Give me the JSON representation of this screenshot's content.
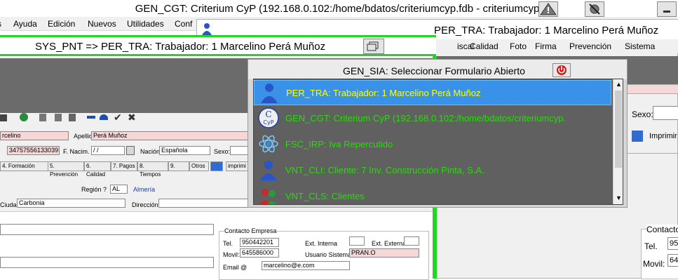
{
  "main_window": {
    "title": "GEN_CGT: Criterium CyP (192.168.0.102:/home/bdatos/criteriumcyp.fdb - criteriumcyp)",
    "menu": [
      "s",
      "Ayuda",
      "Edición",
      "Nuevos",
      "Utilidades",
      "Conf"
    ]
  },
  "pertra_window": {
    "title": "PER_TRA: Trabajador: 1 Marcelino Perá Muñoz",
    "menu": [
      "iscal",
      "Calidad",
      "Foto",
      "Firma",
      "Prevención",
      "Sistema"
    ],
    "sexo_label": "Sexo:",
    "imprimir_label": "Imprimir",
    "contacto_label": "Contacto",
    "tel_label": "Tel.",
    "tel_value": "95",
    "movil_label": "Movil:",
    "movil_value": "64"
  },
  "syspnt_window": {
    "title": "SYS_PNT => PER_TRA: Trabajador: 1 Marcelino Perá Muñoz",
    "form": {
      "nombre_value": "rcelino",
      "apellido_label": "Apellido:",
      "apellido_value": "Perá Muñoz",
      "nif_value": "34757556133039",
      "fnacim_label": "F. Nacim.",
      "fnacim_value": "/ /",
      "nacion_label": "Nación:",
      "nacion_value": "Española",
      "sexo_label": "Sexo:",
      "tabs": [
        "4. Formación",
        "5. Prevención",
        "6. Calidad",
        "7. Pagos",
        "8. Tiempos",
        "9. ",
        "Otros",
        "imprimi"
      ],
      "region_label": "Región ?",
      "region_code": "AL",
      "region_value": "Almería",
      "ciudad_label": "Ciudad:",
      "ciudad_value": "Carbonia",
      "direccion_label": "Dirección:",
      "contacto_label": "Contacto Empresa",
      "tel_label": "Tel.",
      "tel_value": "950442201",
      "ext_interna_label": "Ext. Interna",
      "ext_externa_label": "Ext. Externa",
      "movil_label": "Movil:",
      "movil_value": "645586000",
      "usuario_label": "Usuario Sistema ?",
      "usuario_value": "PRAN.O",
      "email_label": "Email @",
      "email_value": "marcelino@e.com"
    }
  },
  "dialog": {
    "title": "GEN_SIA: Seleccionar Formulario Abierto",
    "items": [
      {
        "label": "PER_TRA: Trabajador: 1 Marcelino Perá Muñoz",
        "icon": "person-icon",
        "color": "#ffff00"
      },
      {
        "label": "GEN_CGT: Criterium CyP (192.168.0.102:/home/bdatos/criteriumcyp.",
        "icon": "cyp-logo-icon",
        "color": "#22e000"
      },
      {
        "label": "FSC_IRP: Iva Repercutido",
        "icon": "atom-icon",
        "color": "#22e000"
      },
      {
        "label": "VNT_CLI: Cliente: 7 Inv. Construcción Pinta, S.A.",
        "icon": "person-icon",
        "color": "#22e000"
      },
      {
        "label": "VNT_CLS: Clientes",
        "icon": "people-icon",
        "color": "#22e000"
      }
    ]
  },
  "colors": {
    "accent_green": "#22d622",
    "selection_blue": "#3a92e8",
    "list_bg": "#606060"
  }
}
